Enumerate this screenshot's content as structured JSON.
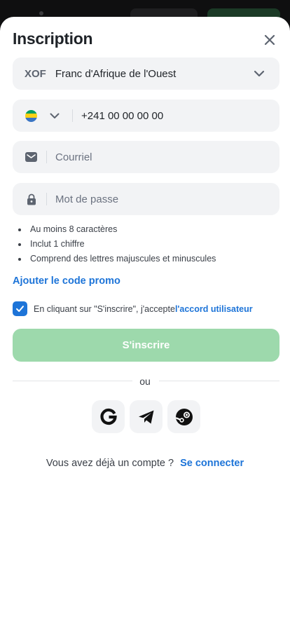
{
  "header": {
    "title": "Inscription",
    "close_icon": "close-icon"
  },
  "currency": {
    "code": "XOF",
    "name": "Franc d'Afrique de l'Ouest",
    "icon": "chevron-down-icon"
  },
  "phone": {
    "flag": "gabon-flag-icon",
    "flag_colors": [
      "#009E60",
      "#FCD116",
      "#3A75C4"
    ],
    "placeholder": "+241 00 00 00 00"
  },
  "email": {
    "icon": "mail-icon",
    "placeholder": "Courriel"
  },
  "password": {
    "icon": "lock-icon",
    "placeholder": "Mot de passe"
  },
  "password_rules": [
    "Au moins 8 caractères",
    "Inclut 1 chiffre",
    "Comprend des lettres majuscules et minuscules"
  ],
  "promo": {
    "label": "Ajouter le code promo"
  },
  "agreement": {
    "checked": true,
    "text": "En cliquant sur \"S'inscrire\", j'accepte ",
    "link": "l'accord utilisateur"
  },
  "submit": {
    "label": "S'inscrire"
  },
  "divider": {
    "label": "ou"
  },
  "social": [
    {
      "name": "google",
      "icon": "google-icon"
    },
    {
      "name": "telegram",
      "icon": "telegram-icon"
    },
    {
      "name": "steam",
      "icon": "steam-icon"
    }
  ],
  "login": {
    "prompt": "Vous avez déjà un compte ?",
    "link": "Se connecter"
  },
  "colors": {
    "accent": "#1d74d8",
    "submit_bg": "#9dd9ac",
    "field_bg": "#f2f3f5",
    "backdrop": "#0f0f10"
  }
}
